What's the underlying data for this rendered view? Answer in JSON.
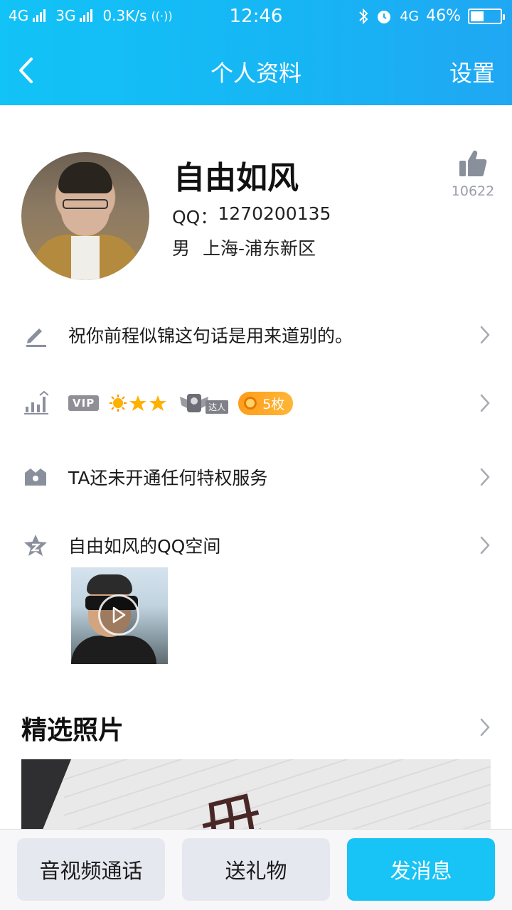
{
  "status_bar": {
    "network1": "4G",
    "network2": "3G",
    "speed": "0.3K/s",
    "time": "12:46",
    "network3": "4G",
    "battery": "46%",
    "battery_level": 0.46
  },
  "nav": {
    "title": "个人资料",
    "settings_label": "设置"
  },
  "profile": {
    "nickname": "自由如风",
    "qq_label": "QQ：",
    "qq_number": "1270200135",
    "gender": "男",
    "location": "上海-浦东新区",
    "like_count": "10622"
  },
  "rows": {
    "signature": "祝你前程似锦这句话是用来道别的。",
    "vip_tag": "VIP",
    "daren_label": "达人",
    "medal_text": "5枚",
    "privilege": "TA还未开通任何特权服务",
    "qzone": "自由如风的QQ空间"
  },
  "featured": {
    "title": "精选照片",
    "photo_char": "毋"
  },
  "buttons": {
    "call": "音视频通话",
    "gift": "送礼物",
    "message": "发消息"
  },
  "colors": {
    "header": "#16b6f4",
    "accent_button": "#18c3f5",
    "medal": "#ffa524",
    "icon_gray": "#8a8f9c"
  },
  "icons": {
    "back": "chevron-left-icon",
    "like": "thumbs-up-icon",
    "signature": "pencil-icon",
    "level": "level-chart-icon",
    "privilege": "crown-icon",
    "qzone": "star-icon",
    "chevron": "chevron-right-icon",
    "play": "play-icon"
  }
}
